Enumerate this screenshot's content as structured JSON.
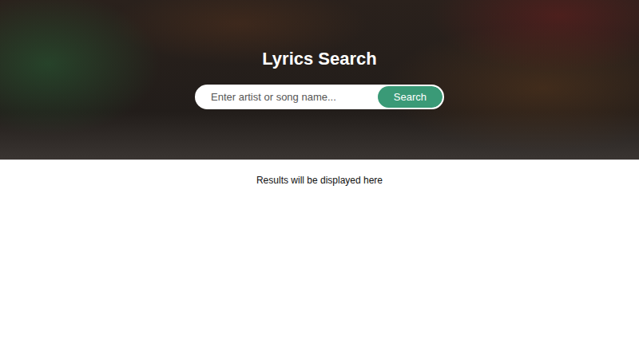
{
  "header": {
    "title": "Lyrics Search"
  },
  "search": {
    "placeholder": "Enter artist or song name...",
    "button": "Search"
  },
  "results": {
    "message": "Results will be displayed here"
  }
}
